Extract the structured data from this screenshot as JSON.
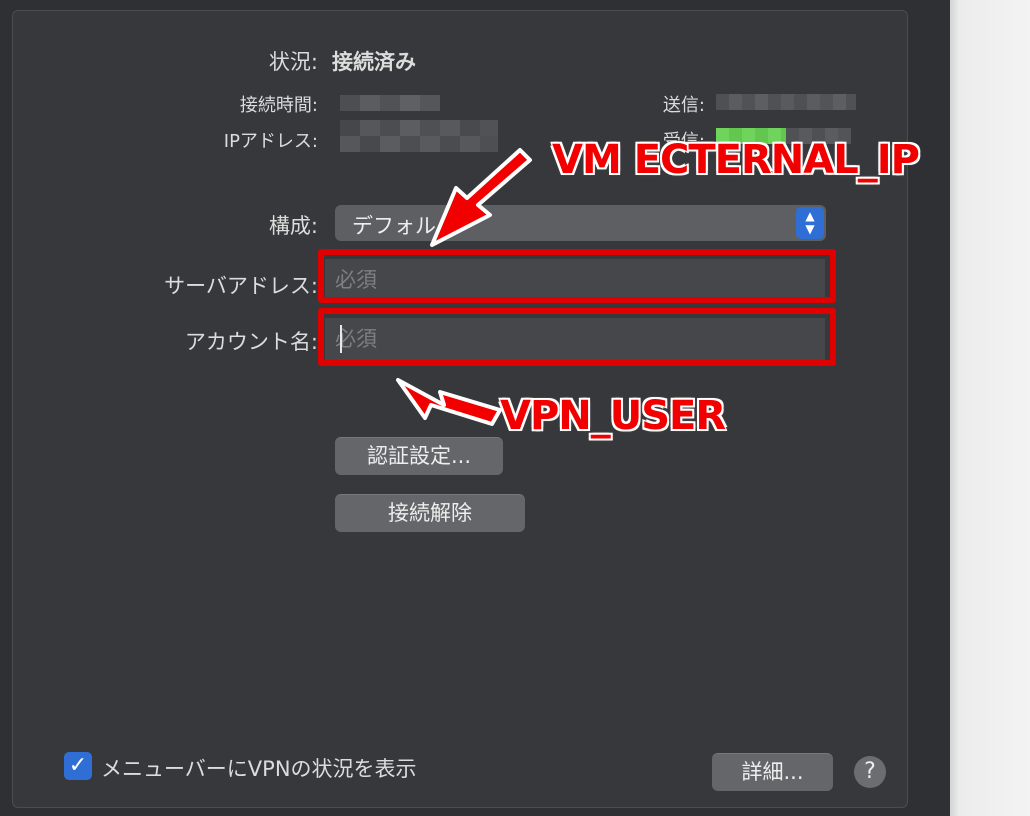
{
  "status": {
    "label": "状況:",
    "value": "接続済み",
    "connect_time_label": "接続時間:",
    "ip_address_label": "IPアドレス:",
    "sent_label": "送信:",
    "received_label": "受信:",
    "received_level": 0.5
  },
  "config": {
    "label": "構成:",
    "selected": "デフォルト"
  },
  "server_address": {
    "label": "サーバアドレス:",
    "value": "",
    "placeholder": "必須"
  },
  "account_name": {
    "label": "アカウント名:",
    "value": "",
    "placeholder": "必須"
  },
  "buttons": {
    "auth_settings": "認証設定...",
    "disconnect": "接続解除",
    "advanced": "詳細...",
    "help": "?"
  },
  "menu_bar_option": {
    "label": "メニューバーにVPNの状況を表示",
    "checked": true
  },
  "annotations": {
    "server_note": "VM ECTERNAL_IP",
    "account_note": "VPN_USER",
    "color": "#f20000"
  },
  "icons": {
    "popup": "up-down-chevron-icon",
    "checkbox": "checkmark-icon",
    "help": "question-mark-icon",
    "annotation_arrow": "arrow-icon"
  },
  "colors": {
    "panel_bg": "#36383b",
    "accent": "#2f6fd5",
    "highlight": "#e00000",
    "received_meter": "#6fd35c"
  }
}
